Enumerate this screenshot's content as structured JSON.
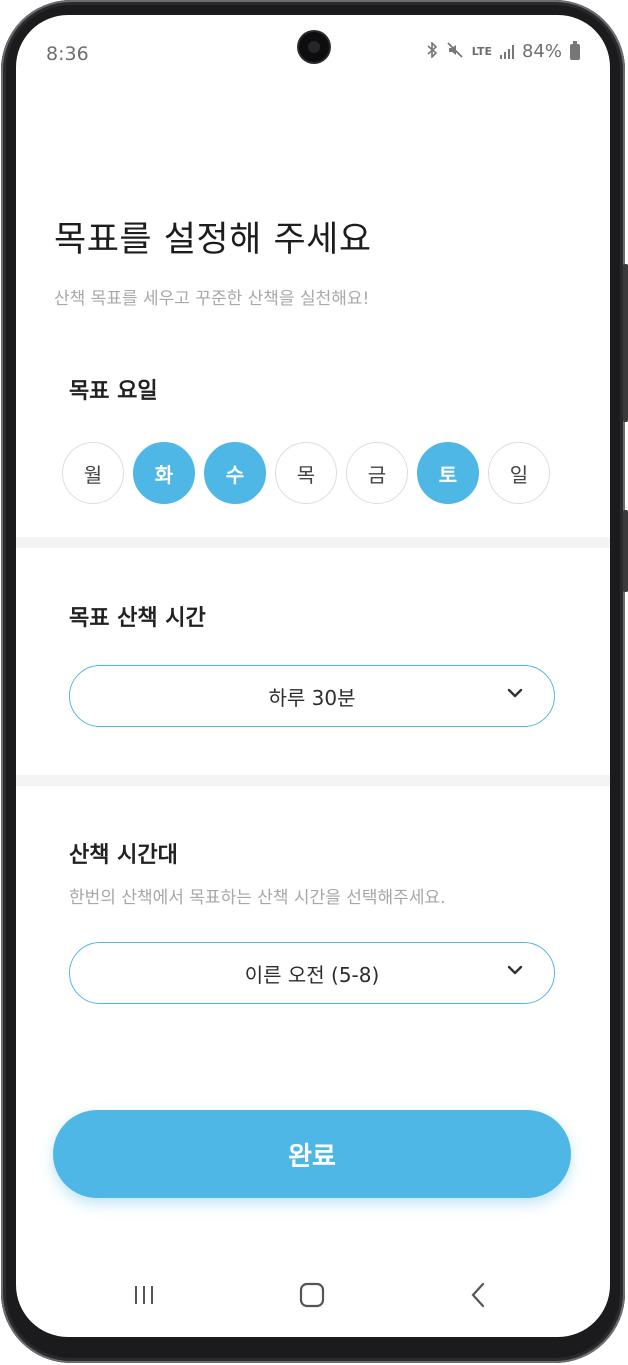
{
  "status_bar": {
    "time": "8:36",
    "network": "LTE",
    "battery": "84%"
  },
  "header": {
    "title": "목표를 설정해 주세요",
    "subtitle": "산책 목표를 세우고 꾸준한 산책을 실천해요!"
  },
  "goal_days": {
    "label": "목표 요일",
    "days": [
      {
        "label": "월",
        "selected": false
      },
      {
        "label": "화",
        "selected": true
      },
      {
        "label": "수",
        "selected": true
      },
      {
        "label": "목",
        "selected": false
      },
      {
        "label": "금",
        "selected": false
      },
      {
        "label": "토",
        "selected": true
      },
      {
        "label": "일",
        "selected": false
      }
    ]
  },
  "walk_duration": {
    "label": "목표 산책 시간",
    "value": "하루 30분"
  },
  "walk_time_slot": {
    "label": "산책 시간대",
    "hint": "한번의 산책에서 목표하는 산책 시간을 선택해주세요.",
    "value": "이른 오전 (5-8)"
  },
  "done_button": {
    "label": "완료"
  },
  "nav_bar": {
    "items": [
      "recent-apps-icon",
      "home-icon",
      "back-icon"
    ]
  },
  "colors": {
    "accent": "#4fb7e6",
    "divider": "#f4f4f4",
    "text": "#1d1d1d"
  }
}
